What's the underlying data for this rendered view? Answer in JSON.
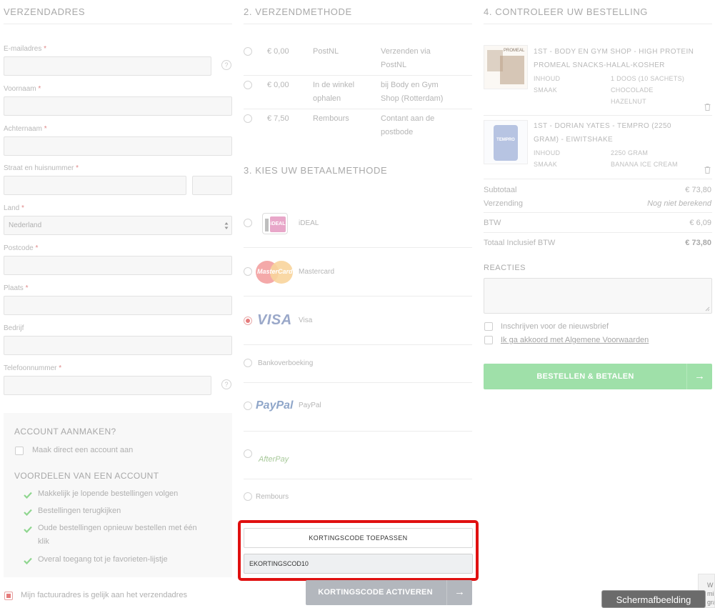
{
  "shipping_address": {
    "title": "VERZENDADRES",
    "fields": [
      {
        "label": "E-mailadres",
        "required": "*"
      },
      {
        "label": "Voornaam",
        "required": "*"
      },
      {
        "label": "Achternaam",
        "required": "*"
      },
      {
        "label": "Straat en huisnummer",
        "required": "*"
      },
      {
        "label": "Land",
        "required": "*",
        "value": "Nederland"
      },
      {
        "label": "Postcode",
        "required": "*"
      },
      {
        "label": "Plaats",
        "required": "*"
      },
      {
        "label": "Bedrijf",
        "required": ""
      },
      {
        "label": "Telefoonnummer",
        "required": "*"
      }
    ],
    "help_glyph": "?"
  },
  "account": {
    "title": "ACCOUNT AANMAKEN?",
    "checkbox_label": "Maak direct een account aan",
    "benefits_title": "VOORDELEN VAN EEN ACCOUNT",
    "benefits": [
      "Makkelijk je lopende bestellingen volgen",
      "Bestellingen terugkijken",
      "Oude bestellingen opnieuw bestellen met één",
      "klik",
      "Overal toegang tot je favorieten-lijstje"
    ]
  },
  "billing_same_label": "Mijn factuuradres is gelijk aan het verzendadres",
  "shipping_method": {
    "title": "2. VERZENDMETHODE",
    "options": [
      {
        "price": "€ 0,00",
        "name": "PostNL",
        "desc1": "Verzenden via",
        "desc2": "PostNL"
      },
      {
        "price": "€ 0,00",
        "name1": "In de winkel",
        "name2": "ophalen",
        "desc1": "bij Body en Gym",
        "desc2": "Shop (Rotterdam)"
      },
      {
        "price": "€ 7,50",
        "name": "Rembours",
        "desc1": "Contant aan de",
        "desc2": "postbode"
      }
    ]
  },
  "payment_method": {
    "title": "3. KIES UW BETAALMETHODE",
    "options": [
      {
        "label": "iDEAL",
        "logo": "iDEAL"
      },
      {
        "label": "Mastercard",
        "logo": "MasterCard"
      },
      {
        "label": "Visa",
        "logo": "VISA",
        "selected": true
      },
      {
        "label": "Bankoverboeking"
      },
      {
        "label": "PayPal",
        "logo": "PayPal"
      },
      {
        "label": "",
        "logo": "AfterPay"
      },
      {
        "label": "Rembours"
      }
    ]
  },
  "discount": {
    "apply_button": "KORTINGSCODE TOEPASSEN",
    "code_value": "EKORTINGSCOD10",
    "activate_button": "KORTINGSCODE ACTIVEREN",
    "arrow": "→"
  },
  "order_review": {
    "title": "4. CONTROLEER UW BESTELLING",
    "items": [
      {
        "title1": "1ST - BODY EN GYM SHOP - HIGH PROTEIN",
        "title2": "PROMEAL SNACKS-HALAL-KOSHER",
        "specs": [
          {
            "key": "INHOUD",
            "value": "1 DOOS (10 SACHETS)"
          },
          {
            "key": "SMAAK",
            "value": "CHOCOLADE"
          },
          {
            "key": "",
            "value": "HAZELNUT"
          }
        ],
        "thumb_text": "PROMEAL"
      },
      {
        "title1": "1ST - DORIAN YATES - TEMPRO (2250",
        "title2": "GRAM) - EIWITSHAKE",
        "specs": [
          {
            "key": "INHOUD",
            "value": "2250 GRAM"
          },
          {
            "key": "SMAAK",
            "value": "BANANA ICE CREAM"
          }
        ],
        "thumb_text": "TEMPRO"
      }
    ],
    "summary": [
      {
        "label": "Subtotaal",
        "value": "€ 73,80"
      },
      {
        "label": "Verzending",
        "value": "Nog niet berekend"
      },
      {
        "label": "BTW",
        "value": "€ 6,09"
      },
      {
        "label": "Totaal Inclusief BTW",
        "value": "€ 73,80"
      }
    ],
    "comments_title": "REACTIES",
    "newsletter_label": "Inschrijven voor de nieuwsbrief",
    "terms_label": "Ik ga akkoord met Algemene Voorwaarden",
    "order_button": "BESTELLEN & BETALEN",
    "arrow": "→"
  },
  "tooltip": "Schermafbeelding",
  "edge_fragment": [
    "W",
    "mi",
    "gra"
  ],
  "colors": {
    "highlight_border": "#e01010",
    "order_button": "#9fe0a9",
    "activate_button": "#b3b7bd",
    "selected_radio": "#e57b7b",
    "check": "#8fd68f"
  }
}
